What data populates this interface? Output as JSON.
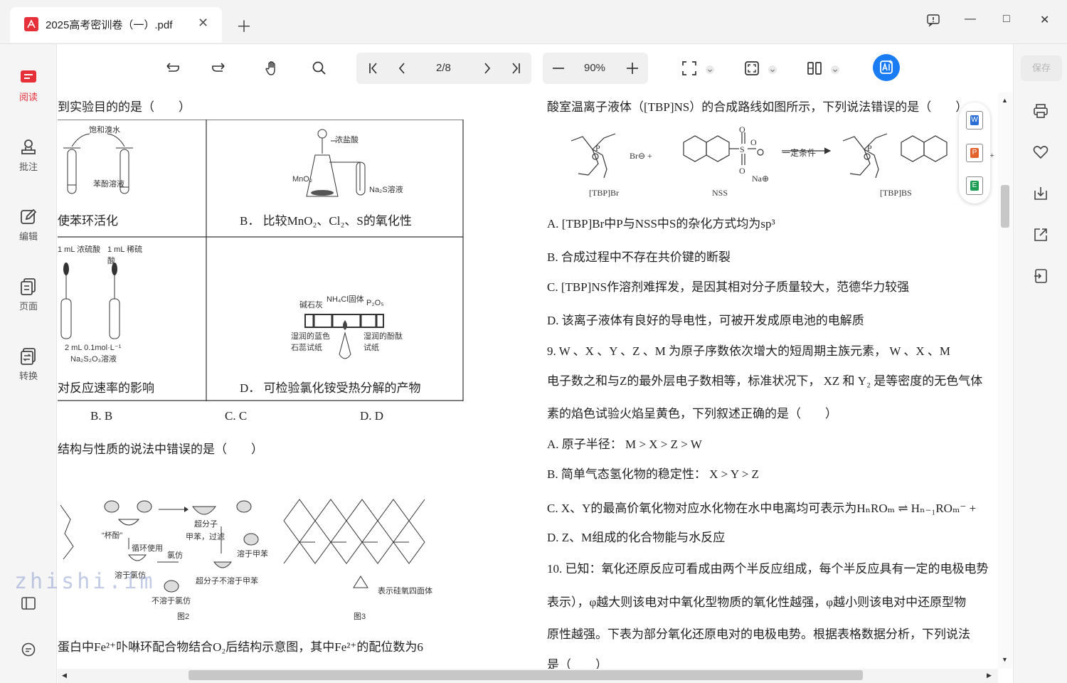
{
  "app": {
    "tab_title": "2025高考密训卷（一）.pdf",
    "window": {
      "feedback_icon": "feedback-icon",
      "minimize": "—",
      "maximize": "□",
      "close": "✕"
    }
  },
  "left_rail": {
    "items": [
      {
        "label": "阅读",
        "active": true
      },
      {
        "label": "批注"
      },
      {
        "label": "编辑"
      },
      {
        "label": "页面"
      },
      {
        "label": "转换"
      }
    ]
  },
  "right_rail": {
    "save_label": "保存"
  },
  "toolbar": {
    "page_indicator": "2/8",
    "zoom_level": "90%"
  },
  "watermark": "zhishi.im",
  "left_column": {
    "q_top": "到实验目的的是（　　）",
    "cellA_caption": "使苯环活化",
    "cellA_labels": [
      "饱和溴水",
      "苯酚溶液"
    ],
    "cellB_caption": "B．  比较MnO₂、Cl₂、S的氧化性",
    "cellB_labels": [
      "浓盐酸",
      "MnO₂",
      "Na₂S溶液"
    ],
    "cellC_caption": "对反应速率的影响",
    "cellC_labels": [
      "1 mL 浓硫酸",
      "1 mL 稀硫酸",
      "2 mL 0.1mol·L⁻¹",
      "Na₂S₂O₃溶液"
    ],
    "cellD_caption": "D．  可检验氯化铵受热分解的产物",
    "cellD_labels": [
      "NH₄Cl固体",
      "碱石灰",
      "P₂O₅",
      "湿润的蓝色石蕊试纸",
      "湿润的酚酞试纸"
    ],
    "options": [
      "B.  B",
      "C.  C",
      "D.  D"
    ],
    "q_next": "结构与性质的说法中错误的是（　　）",
    "fig2_labels": [
      "“杯酚”",
      "超分子",
      "甲苯，过滤",
      "溶于甲苯",
      "循环使用",
      "氯仿",
      "溶于氯仿",
      "超分子不溶于甲苯",
      "不溶于氯仿",
      "图2"
    ],
    "fig3_labels": [
      "表示硅氧四面体",
      "图3"
    ],
    "q_bottom": "蛋白中Fe²⁺卟啉环配合物结合O₂后结构示意图，其中Fe²⁺的配位数为6"
  },
  "right_column": {
    "q8_intro": "酸室温离子液体（[TBP]NS）的合成路线如图所示，下列说法错误的是（　　）",
    "scheme_labels": [
      "[TBP]Br",
      "NSS",
      "[TBP]BS",
      "一定条件",
      "Br⊖ +",
      "Na⊕"
    ],
    "q8_A": "A.  [TBP]Br中P与NSS中S的杂化方式均为sp³",
    "q8_B": "B.  合成过程中不存在共价键的断裂",
    "q8_C": "C.  [TBP]NS作溶剂难挥发，是因其相对分子质量较大，范德华力较强",
    "q8_D": "D.  该离子液体有良好的导电性，可被开发成原电池的电解质",
    "q9_line1": "9.   W 、X 、Y 、Z 、M 为原子序数依次增大的短周期主族元素， W 、X 、M",
    "q9_line2": "电子数之和与Z的最外层电子数相等，标准状况下， XZ 和 Y₂ 是等密度的无色气体",
    "q9_line3": "素的焰色试验火焰呈黄色，下列叙述正确的是（　　）",
    "q9_A": "A.  原子半径： M > X > Z > W",
    "q9_B": "B.  简单气态氢化物的稳定性： X > Y > Z",
    "q9_C": "C.  X、Y的最高价氧化物对应水化物在水中电离均可表示为HₙROₘ ⇌ Hₙ₋₁ROₘ⁻ +",
    "q9_D": "D.  Z、M组成的化合物能与水反应",
    "q10_line1": "10. 已知：氧化还原反应可看成由两个半反应组成，每个半反应具有一定的电极电势",
    "q10_line2": "表示），φ越大则该电对中氧化型物质的氧化性越强，φ越小则该电对中还原型物",
    "q10_line3": "原性越强。下表为部分氧化还原电对的电极电势。根据表格数据分析，下列说法",
    "q10_line4": "是（　　）"
  }
}
